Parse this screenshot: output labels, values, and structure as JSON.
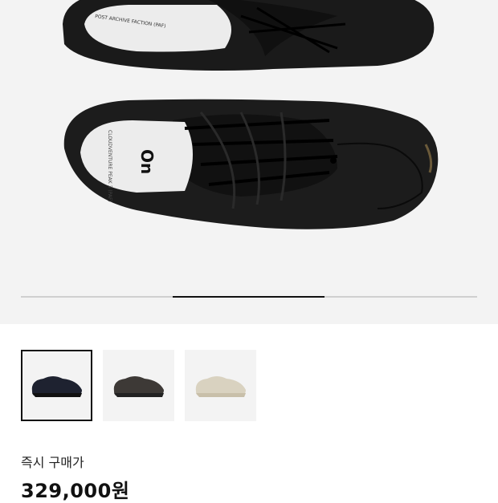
{
  "gallery": {
    "brand_logo_text": "On",
    "insole_text_1": "CLOUDVENTURE PEAK 3 (PAF)",
    "insole_text_2": "POST ARCHIVE FACTION (PAF)",
    "slide_progress_fraction": 0.333,
    "slide_progress_start_fraction": 0.333
  },
  "thumbnails": [
    {
      "name": "black",
      "color": "#1e2230",
      "selected": true
    },
    {
      "name": "dark-brown",
      "color": "#3d3936",
      "selected": false
    },
    {
      "name": "cream",
      "color": "#d9d2c0",
      "selected": false
    }
  ],
  "purchase": {
    "label": "즉시 구매가",
    "price": "329,000원"
  }
}
